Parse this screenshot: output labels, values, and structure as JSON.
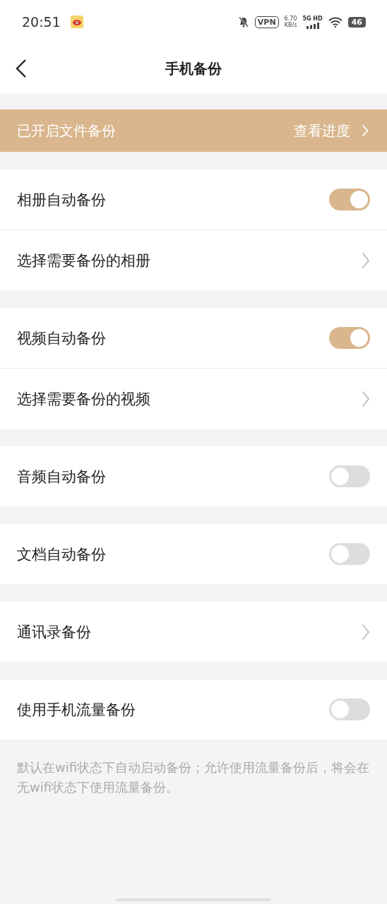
{
  "status_bar": {
    "time": "20:51",
    "vpn": "VPN",
    "speed": "6.70",
    "speed_unit": "KB/s",
    "network": "5G HD",
    "battery": "46"
  },
  "nav": {
    "title": "手机备份"
  },
  "banner": {
    "label": "已开启文件备份",
    "action": "查看进度"
  },
  "sections": [
    {
      "items": [
        {
          "kind": "toggle",
          "label": "相册自动备份",
          "on": true
        },
        {
          "kind": "link",
          "label": "选择需要备份的相册"
        }
      ]
    },
    {
      "items": [
        {
          "kind": "toggle",
          "label": "视频自动备份",
          "on": true
        },
        {
          "kind": "link",
          "label": "选择需要备份的视频"
        }
      ]
    },
    {
      "items": [
        {
          "kind": "toggle",
          "label": "音频自动备份",
          "on": false
        }
      ]
    },
    {
      "items": [
        {
          "kind": "toggle",
          "label": "文档自动备份",
          "on": false
        }
      ]
    },
    {
      "items": [
        {
          "kind": "link",
          "label": "通讯录备份"
        }
      ]
    },
    {
      "items": [
        {
          "kind": "toggle",
          "label": "使用手机流量备份",
          "on": false
        }
      ]
    }
  ],
  "footnote": "默认在wifi状态下自动启动备份；允许使用流量备份后，将会在无wifi状态下使用流量备份。"
}
